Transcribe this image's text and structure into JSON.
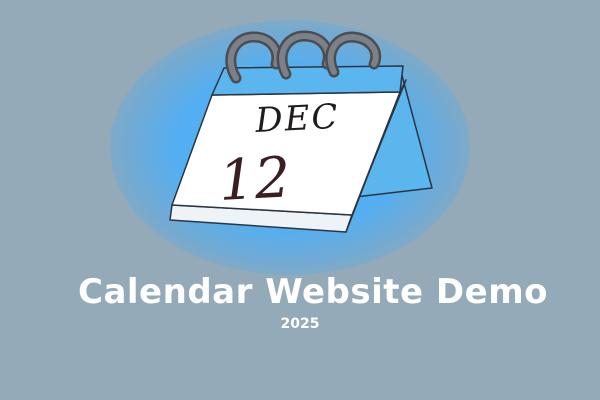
{
  "calendar_icon": {
    "month": "DEC",
    "day": "12"
  },
  "title": "Calendar Website Demo",
  "year": "2025",
  "colors": {
    "background": "#94aab8",
    "glow": "#50aff5",
    "text": "#ffffff",
    "page": "#ffffff",
    "binding": "#5bb6f0",
    "rings": "#6b6e73"
  }
}
